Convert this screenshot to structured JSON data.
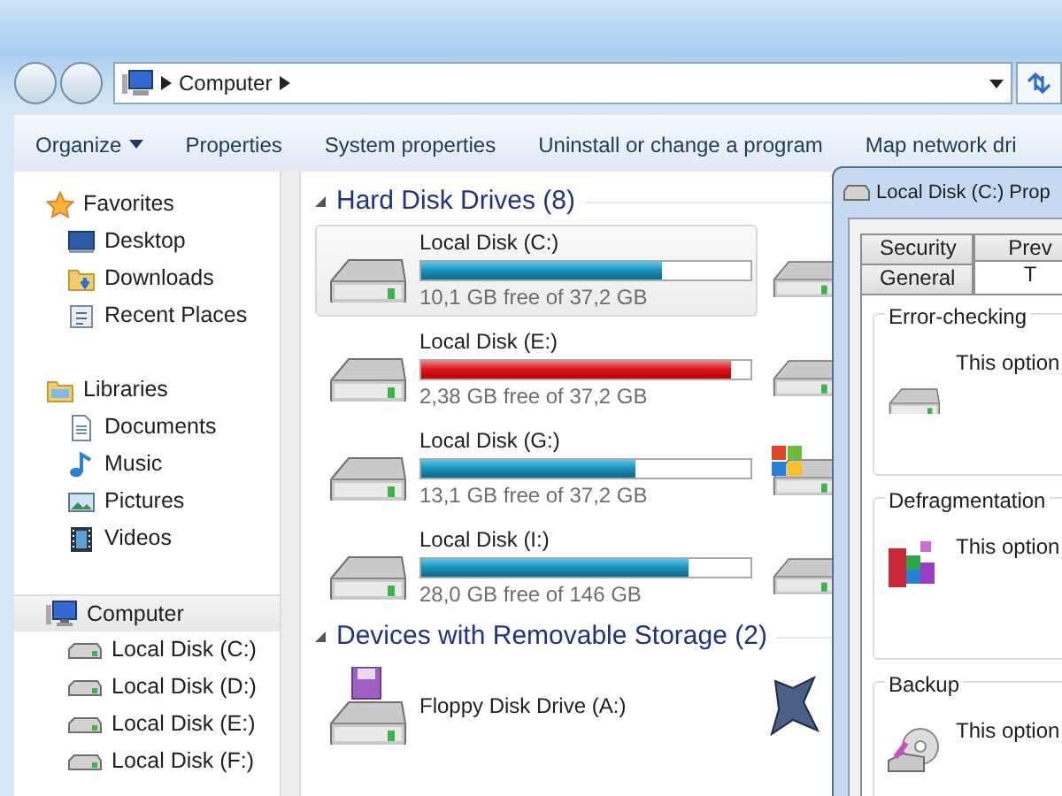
{
  "address_bar": {
    "crumbs": [
      "Computer"
    ]
  },
  "toolbar": [
    {
      "label": "Organize",
      "dropdown": true
    },
    {
      "label": "Properties",
      "dropdown": false
    },
    {
      "label": "System properties",
      "dropdown": false
    },
    {
      "label": "Uninstall or change a program",
      "dropdown": false
    },
    {
      "label": "Map network dri",
      "dropdown": false
    }
  ],
  "sidebar": {
    "sections": [
      {
        "label": "Favorites",
        "kind": "star",
        "selected": false,
        "children": [
          {
            "label": "Desktop",
            "kind": "desktop"
          },
          {
            "label": "Downloads",
            "kind": "downloads"
          },
          {
            "label": "Recent Places",
            "kind": "recent"
          }
        ]
      },
      {
        "label": "Libraries",
        "kind": "library",
        "selected": false,
        "children": [
          {
            "label": "Documents",
            "kind": "document"
          },
          {
            "label": "Music",
            "kind": "music"
          },
          {
            "label": "Pictures",
            "kind": "picture"
          },
          {
            "label": "Videos",
            "kind": "video"
          }
        ]
      },
      {
        "label": "Computer",
        "kind": "computer",
        "selected": true,
        "children": [
          {
            "label": "Local Disk (C:)",
            "kind": "drive"
          },
          {
            "label": "Local Disk (D:)",
            "kind": "drive"
          },
          {
            "label": "Local Disk (E:)",
            "kind": "drive"
          },
          {
            "label": "Local Disk (F:)",
            "kind": "drive"
          }
        ]
      }
    ]
  },
  "groups": [
    {
      "title": "Hard Disk Drives (8)",
      "items": [
        {
          "name": "Local Disk (C:)",
          "free": "10,1 GB free of 37,2 GB",
          "level": 0.73,
          "low_space": false,
          "selected": true
        },
        {
          "name": "Local Disk (E:)",
          "free": "2,38 GB free of 37,2 GB",
          "level": 0.94,
          "low_space": true,
          "selected": false
        },
        {
          "name": "Local Disk (G:)",
          "free": "13,1 GB free of 37,2 GB",
          "level": 0.65,
          "low_space": false,
          "selected": false
        },
        {
          "name": "Local Disk (I:)",
          "free": "28,0 GB free of 146 GB",
          "level": 0.81,
          "low_space": false,
          "selected": false
        }
      ],
      "second_column": [
        {
          "kind": "drive"
        },
        {
          "kind": "drive"
        },
        {
          "kind": "system"
        },
        {
          "kind": "drive"
        }
      ]
    },
    {
      "title": "Devices with Removable Storage (2)",
      "items": [
        {
          "name": "Floppy Disk Drive (A:)",
          "kind": "floppy",
          "selected": false
        }
      ],
      "second_column": [
        {
          "kind": "logo"
        }
      ]
    }
  ],
  "dialog": {
    "title": "Local Disk (C:) Prop",
    "tabs_back": [
      {
        "label": "Security",
        "selected": false
      },
      {
        "label": "Prev",
        "selected": false
      }
    ],
    "tabs_front": [
      {
        "label": "General",
        "selected": false
      },
      {
        "label": "T",
        "selected": true
      }
    ],
    "sections": [
      {
        "title": "Error-checking",
        "text": "This option",
        "kind": "drive"
      },
      {
        "title": "Defragmentation",
        "text": "This option",
        "kind": "defrag"
      },
      {
        "title": "Backup",
        "text": "This option",
        "kind": "backup"
      }
    ]
  }
}
